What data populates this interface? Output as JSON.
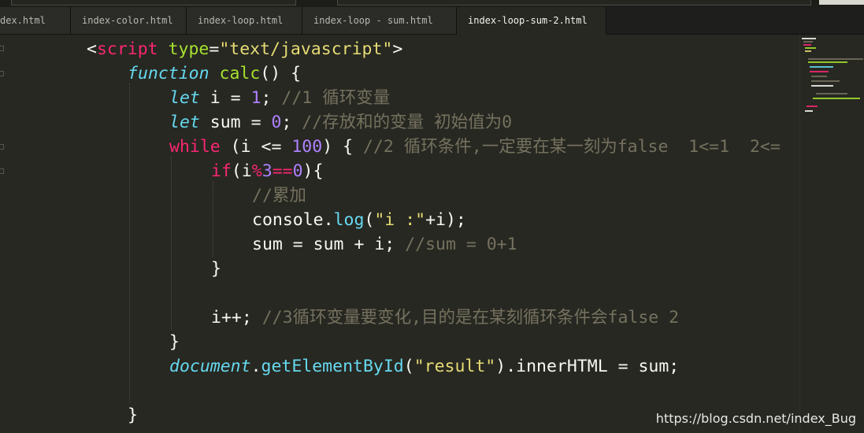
{
  "tabs": [
    {
      "label": "dex.html",
      "active": false
    },
    {
      "label": "index-color.html",
      "active": false
    },
    {
      "label": "index-loop.html",
      "active": false
    },
    {
      "label": "index-loop - sum.html",
      "active": false
    },
    {
      "label": "index-loop-sum-2.html",
      "active": true
    }
  ],
  "code": {
    "l1": {
      "t1": "<",
      "t2": "script",
      "t3": " type",
      "t4": "=",
      "t5": "\"text/javascript\"",
      "t6": ">"
    },
    "l2": {
      "t1": "function",
      "t2": " calc",
      "t3": "() {"
    },
    "l3": {
      "t1": "let",
      "t2": " i = ",
      "t3": "1",
      "t4": "; ",
      "t5": "//1 循环变量"
    },
    "l4": {
      "t1": "let",
      "t2": " sum = ",
      "t3": "0",
      "t4": "; ",
      "t5": "//存放和的变量 初始值为0"
    },
    "l5": {
      "t1": "while",
      "t2": " (i <= ",
      "t3": "100",
      "t4": ") { ",
      "t5": "//2 循环条件,一定要在某一刻为false  1<=1  2<="
    },
    "l6": {
      "t1": "if",
      "t2": "(i",
      "t3": "%",
      "t4": "3",
      "t5": "==",
      "t6": "0",
      "t7": "){"
    },
    "l7": {
      "t1": "//累加"
    },
    "l8": {
      "t1": "console.",
      "t2": "log",
      "t3": "(",
      "t4": "\"i :\"",
      "t5": "+i);"
    },
    "l9": {
      "t1": "sum = sum + i; ",
      "t2": "//sum = 0+1"
    },
    "l10": {
      "t1": "}"
    },
    "l11": {
      "t1": "i++; ",
      "t2": "//3循环变量要变化,目的是在某刻循环条件会false 2"
    },
    "l12": {
      "t1": "}"
    },
    "l13": {
      "t1": "document",
      "t2": ".",
      "t3": "getElementById",
      "t4": "(",
      "t5": "\"result\"",
      "t6": ").innerHTML = sum;"
    },
    "l14": {
      "t1": "}"
    }
  },
  "watermark": "https://blog.csdn.net/index_Bug",
  "colors": {
    "background": "#272822",
    "keyword": "#f92672",
    "string": "#e6db74",
    "function": "#a6e22e",
    "storage": "#66d9ef",
    "number": "#ae81ff",
    "comment": "#75715e"
  }
}
